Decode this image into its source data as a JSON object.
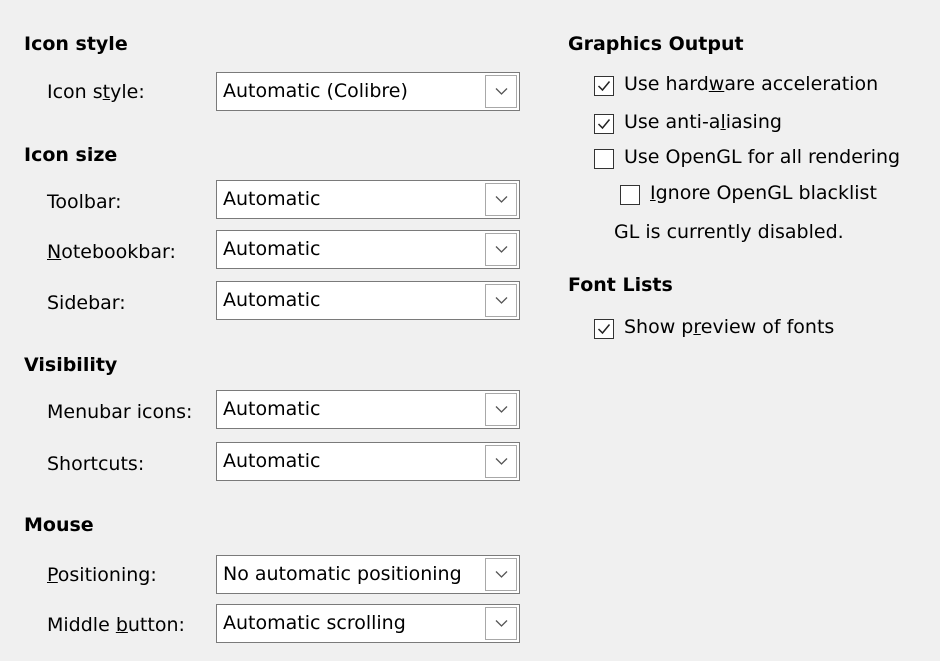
{
  "left": {
    "icon_style_section": {
      "title": "Icon style",
      "rows": [
        {
          "label_pre": "Icon s",
          "label_acc": "t",
          "label_post": "yle:",
          "value": "Automatic (Colibre)"
        }
      ]
    },
    "icon_size_section": {
      "title": "Icon size",
      "rows": [
        {
          "label_pre": "",
          "label_acc": "",
          "label_post": "Toolbar:",
          "value": "Automatic"
        },
        {
          "label_pre": "",
          "label_acc": "N",
          "label_post": "otebookbar:",
          "value": "Automatic"
        },
        {
          "label_pre": "",
          "label_acc": "",
          "label_post": "Sidebar:",
          "value": "Automatic"
        }
      ]
    },
    "visibility_section": {
      "title": "Visibility",
      "rows": [
        {
          "label_pre": "",
          "label_acc": "",
          "label_post": "Menubar icons:",
          "value": "Automatic"
        },
        {
          "label_pre": "",
          "label_acc": "",
          "label_post": "Shortcuts:",
          "value": "Automatic"
        }
      ]
    },
    "mouse_section": {
      "title": "Mouse",
      "rows": [
        {
          "label_pre": "",
          "label_acc": "P",
          "label_post": "ositioning:",
          "value": "No automatic positioning"
        },
        {
          "label_pre": "Middle ",
          "label_acc": "b",
          "label_post": "utton:",
          "value": "Automatic scrolling"
        }
      ]
    }
  },
  "right": {
    "graphics_output": {
      "title": "Graphics Output",
      "checkboxes": [
        {
          "pre": "Use hard",
          "acc": "w",
          "post": "are acceleration",
          "checked": true
        },
        {
          "pre": "Use anti-a",
          "acc": "l",
          "post": "iasing",
          "checked": true
        },
        {
          "pre": "Use OpenGL for all rendering",
          "acc": "",
          "post": "",
          "checked": false
        },
        {
          "pre": "",
          "acc": "I",
          "post": "gnore OpenGL blacklist",
          "checked": false
        }
      ],
      "status": "GL is currently disabled."
    },
    "font_lists": {
      "title": "Font Lists",
      "checkboxes": [
        {
          "pre": "Show p",
          "acc": "r",
          "post": "eview of fonts",
          "checked": true
        }
      ]
    }
  },
  "icons": {
    "dropdown": "chevron-down-icon",
    "check": "checkmark-icon"
  }
}
